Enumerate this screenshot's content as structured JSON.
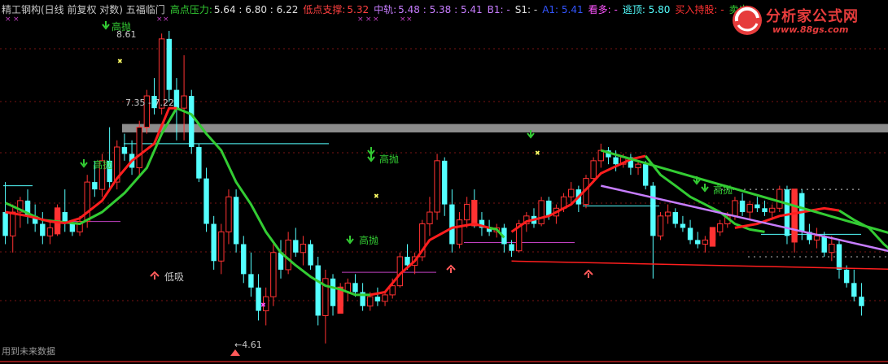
{
  "header": {
    "title": "精工钢构(日线 前复权 对数) 五福临门",
    "high_press_label": "高点压力:",
    "high_press_values": "5.64 : 6.80 : 6.22",
    "low_support_label": "低点支撑:",
    "low_support_value": "5.32",
    "mid_label": "中轨:",
    "mid_values": "5.48 : 5.38 : 5.41",
    "b1": "B1: -",
    "s1": "S1: -",
    "a1": "A1: 5.41",
    "look_long": "看多: -",
    "escape_top": "逃顶: 5.80",
    "buy_hold": "买入持股: -",
    "sell": "卖出"
  },
  "watermark": {
    "title": "分析家公式网",
    "url": "www.88gs.com"
  },
  "footer_note": "用到未来数据",
  "colors": {
    "up": "#ff3232",
    "down": "#54ffff",
    "green_line": "#33cc33",
    "red_line": "#ff1e1e",
    "purple_line": "#c77dff",
    "grid": "#7a1414",
    "header_title": "#c8c8c8"
  },
  "chart_data": {
    "type": "candlestick",
    "price_range": [
      4.5,
      9.2
    ],
    "candles": [
      [
        6.1,
        6.5,
        5.7,
        5.8
      ],
      [
        5.8,
        6.2,
        5.6,
        6.1
      ],
      [
        6.1,
        6.3,
        5.9,
        6.25
      ],
      [
        6.25,
        6.4,
        5.95,
        6.05
      ],
      [
        6.05,
        6.2,
        5.85,
        5.95
      ],
      [
        5.95,
        6.1,
        5.7,
        5.8
      ],
      [
        5.8,
        6.0,
        5.7,
        5.9
      ],
      [
        5.9,
        6.2,
        5.8,
        6.1
      ],
      [
        6.1,
        6.4,
        5.85,
        5.95
      ],
      [
        5.95,
        6.0,
        5.8,
        5.85
      ],
      [
        5.85,
        6.05,
        5.8,
        5.98
      ],
      [
        5.98,
        6.6,
        5.9,
        6.5
      ],
      [
        6.5,
        6.8,
        6.3,
        6.4
      ],
      [
        6.4,
        6.9,
        6.3,
        6.8
      ],
      [
        6.8,
        7.3,
        6.4,
        6.5
      ],
      [
        6.5,
        7.1,
        6.4,
        7.0
      ],
      [
        7.0,
        7.2,
        6.8,
        6.9
      ],
      [
        6.9,
        7.1,
        6.6,
        6.7
      ],
      [
        6.7,
        7.4,
        6.6,
        7.3
      ],
      [
        7.3,
        7.9,
        7.2,
        7.8
      ],
      [
        7.8,
        8.1,
        7.5,
        7.6
      ],
      [
        7.6,
        8.9,
        7.5,
        8.8
      ],
      [
        8.8,
        8.95,
        7.7,
        7.9
      ],
      [
        7.9,
        8.1,
        7.1,
        7.6
      ],
      [
        7.6,
        8.5,
        7.1,
        7.8
      ],
      [
        7.8,
        7.9,
        6.9,
        7.0
      ],
      [
        7.0,
        7.05,
        6.5,
        6.55
      ],
      [
        6.55,
        6.7,
        5.85,
        5.95
      ],
      [
        5.95,
        6.05,
        5.4,
        5.5
      ],
      [
        5.5,
        5.95,
        5.35,
        5.85
      ],
      [
        5.85,
        6.4,
        5.7,
        6.3
      ],
      [
        6.3,
        6.4,
        5.6,
        5.7
      ],
      [
        5.7,
        5.8,
        5.25,
        5.35
      ],
      [
        5.35,
        5.6,
        5.1,
        5.2
      ],
      [
        5.2,
        5.35,
        4.85,
        4.95
      ],
      [
        4.95,
        5.2,
        4.8,
        5.1
      ],
      [
        5.1,
        5.7,
        5.0,
        5.6
      ],
      [
        5.6,
        5.75,
        5.3,
        5.4
      ],
      [
        5.4,
        5.85,
        5.35,
        5.75
      ],
      [
        5.75,
        5.9,
        5.55,
        5.6
      ],
      [
        5.6,
        5.8,
        5.45,
        5.7
      ],
      [
        5.7,
        5.75,
        5.4,
        5.45
      ],
      [
        5.45,
        5.55,
        4.8,
        4.9
      ],
      [
        4.9,
        5.4,
        4.62,
        5.3
      ],
      [
        5.3,
        5.35,
        4.9,
        5.0
      ],
      [
        5.0,
        5.25,
        4.95,
        5.15
      ],
      [
        5.15,
        5.3,
        5.05,
        5.25
      ],
      [
        5.25,
        5.35,
        5.1,
        5.15
      ],
      [
        5.15,
        5.25,
        4.95,
        5.0
      ],
      [
        5.0,
        5.15,
        4.95,
        5.1
      ],
      [
        5.1,
        5.2,
        5.0,
        5.05
      ],
      [
        5.05,
        5.15,
        5.0,
        5.12
      ],
      [
        5.12,
        5.3,
        5.08,
        5.22
      ],
      [
        5.22,
        5.6,
        5.2,
        5.55
      ],
      [
        5.55,
        5.7,
        5.4,
        5.45
      ],
      [
        5.45,
        5.6,
        5.35,
        5.55
      ],
      [
        5.55,
        6.0,
        5.5,
        5.95
      ],
      [
        5.95,
        6.3,
        5.8,
        6.1
      ],
      [
        6.1,
        6.9,
        6.0,
        6.8
      ],
      [
        6.8,
        6.85,
        6.05,
        6.2
      ],
      [
        6.2,
        6.4,
        5.6,
        5.7
      ],
      [
        5.7,
        6.1,
        5.65,
        6.0
      ],
      [
        6.0,
        6.3,
        5.9,
        6.2
      ],
      [
        6.2,
        6.4,
        5.9,
        6.0
      ],
      [
        6.0,
        6.1,
        5.8,
        5.9
      ],
      [
        5.9,
        6.0,
        5.8,
        5.85
      ],
      [
        5.85,
        5.95,
        5.78,
        5.9
      ],
      [
        5.9,
        5.95,
        5.6,
        5.7
      ],
      [
        5.7,
        5.75,
        5.55,
        5.62
      ],
      [
        5.62,
        6.0,
        5.6,
        5.95
      ],
      [
        5.95,
        6.1,
        5.85,
        6.05
      ],
      [
        6.05,
        6.15,
        5.9,
        5.95
      ],
      [
        5.95,
        6.3,
        5.92,
        6.25
      ],
      [
        6.25,
        6.3,
        6.0,
        6.05
      ],
      [
        6.05,
        6.2,
        5.95,
        6.15
      ],
      [
        6.15,
        6.35,
        6.1,
        6.3
      ],
      [
        6.3,
        6.5,
        6.2,
        6.4
      ],
      [
        6.4,
        6.45,
        6.1,
        6.2
      ],
      [
        6.2,
        6.6,
        6.15,
        6.55
      ],
      [
        6.55,
        6.85,
        6.5,
        6.8
      ],
      [
        6.8,
        7.05,
        6.7,
        6.95
      ],
      [
        6.95,
        7.0,
        6.75,
        6.85
      ],
      [
        6.85,
        6.95,
        6.65,
        6.75
      ],
      [
        6.75,
        6.9,
        6.7,
        6.85
      ],
      [
        6.85,
        6.9,
        6.6,
        6.7
      ],
      [
        6.7,
        6.8,
        6.6,
        6.75
      ],
      [
        6.75,
        6.8,
        6.4,
        6.45
      ],
      [
        6.45,
        6.5,
        5.3,
        5.8
      ],
      [
        5.8,
        6.1,
        5.75,
        6.05
      ],
      [
        6.05,
        6.2,
        5.95,
        6.1
      ],
      [
        6.1,
        6.15,
        5.9,
        5.95
      ],
      [
        5.95,
        6.05,
        5.85,
        5.9
      ],
      [
        5.9,
        6.0,
        5.7,
        5.75
      ],
      [
        5.75,
        5.85,
        5.65,
        5.7
      ],
      [
        5.7,
        5.8,
        5.6,
        5.75
      ],
      [
        5.75,
        5.9,
        5.7,
        5.85
      ],
      [
        5.85,
        6.0,
        5.8,
        5.95
      ],
      [
        5.95,
        6.1,
        5.9,
        6.05
      ],
      [
        6.05,
        6.3,
        6.0,
        6.25
      ],
      [
        6.25,
        6.35,
        6.05,
        6.1
      ],
      [
        6.1,
        6.25,
        6.0,
        6.2
      ],
      [
        6.2,
        6.3,
        6.1,
        6.15
      ],
      [
        6.15,
        6.25,
        6.05,
        6.1
      ],
      [
        6.1,
        6.2,
        6.0,
        6.15
      ],
      [
        6.15,
        6.45,
        6.1,
        6.4
      ],
      [
        6.4,
        6.45,
        5.7,
        5.8
      ],
      [
        5.8,
        6.4,
        5.6,
        6.35
      ],
      [
        6.35,
        6.4,
        5.75,
        5.85
      ],
      [
        5.85,
        5.95,
        5.7,
        5.75
      ],
      [
        5.75,
        5.9,
        5.65,
        5.8
      ],
      [
        5.8,
        5.85,
        5.55,
        5.6
      ],
      [
        5.6,
        5.8,
        5.5,
        5.7
      ],
      [
        5.7,
        5.75,
        5.3,
        5.4
      ],
      [
        5.4,
        5.45,
        5.2,
        5.25
      ],
      [
        5.25,
        5.4,
        5.05,
        5.1
      ],
      [
        5.1,
        5.25,
        4.9,
        5.0
      ]
    ],
    "green_line": [
      [
        0,
        6.22
      ],
      [
        5,
        6.0
      ],
      [
        10,
        5.95
      ],
      [
        13,
        6.1
      ],
      [
        16,
        6.35
      ],
      [
        19,
        6.7
      ],
      [
        21,
        7.2
      ],
      [
        23,
        7.6
      ],
      [
        25,
        7.5
      ],
      [
        27,
        7.2
      ],
      [
        29,
        6.95
      ],
      [
        31,
        6.5
      ],
      [
        33,
        6.2
      ],
      [
        35,
        5.85
      ],
      [
        37,
        5.6
      ],
      [
        39,
        5.45
      ],
      [
        41,
        5.32
      ],
      [
        43,
        5.22
      ],
      [
        45,
        5.18
      ],
      [
        47,
        5.12
      ],
      [
        49,
        5.12
      ]
    ],
    "red_line": [
      [
        0,
        6.1
      ],
      [
        3,
        6.05
      ],
      [
        6,
        5.98
      ],
      [
        8,
        5.96
      ],
      [
        10,
        6.02
      ],
      [
        13,
        6.25
      ],
      [
        15,
        6.55
      ],
      [
        17,
        6.8
      ],
      [
        20,
        7.05
      ],
      [
        22,
        7.6
      ],
      [
        23,
        7.6
      ]
    ],
    "red_line2": [
      [
        49,
        5.12
      ],
      [
        51,
        5.15
      ],
      [
        53,
        5.35
      ],
      [
        55,
        5.5
      ],
      [
        57,
        5.75
      ],
      [
        60,
        5.9
      ],
      [
        63,
        5.95
      ],
      [
        65,
        5.9
      ],
      [
        66,
        5.88
      ]
    ],
    "green_line3": [
      [
        65,
        5.9
      ],
      [
        66,
        5.88
      ],
      [
        67,
        5.78
      ]
    ],
    "red_line3": [
      [
        68,
        5.85
      ],
      [
        70,
        5.98
      ],
      [
        73,
        6.05
      ],
      [
        76,
        6.2
      ],
      [
        78,
        6.4
      ],
      [
        80,
        6.62
      ],
      [
        82,
        6.72
      ],
      [
        84,
        6.82
      ],
      [
        86,
        6.87
      ]
    ],
    "green_line4": [
      [
        86,
        6.87
      ],
      [
        88,
        6.6
      ],
      [
        90,
        6.45
      ],
      [
        92,
        6.3
      ],
      [
        94,
        6.2
      ],
      [
        96,
        6.1
      ],
      [
        98,
        5.95
      ],
      [
        100,
        5.88
      ],
      [
        102,
        5.85
      ]
    ],
    "red_line4": [
      [
        98,
        5.9
      ],
      [
        101,
        5.95
      ],
      [
        104,
        6.05
      ],
      [
        107,
        6.1
      ],
      [
        110,
        6.15
      ],
      [
        112,
        6.12
      ]
    ],
    "green_line5": [
      [
        112,
        6.12
      ],
      [
        114,
        6.0
      ],
      [
        116,
        5.9
      ],
      [
        118,
        5.7
      ],
      [
        120,
        5.55
      ],
      [
        122,
        5.45
      ]
    ],
    "green_trend": [
      [
        80,
        6.95
      ],
      [
        122,
        5.75
      ]
    ],
    "purple_trend": [
      [
        80,
        6.45
      ],
      [
        122,
        5.55
      ]
    ],
    "red_flat": [
      [
        68,
        5.5
      ],
      [
        122,
        5.4
      ]
    ],
    "notes": [
      "高抛",
      "高抛",
      "高抛",
      "高抛",
      "高抛",
      "低吸"
    ],
    "labels": {
      "high": "8.61",
      "range": "7.35 - 7.22",
      "low": "4.61",
      "gaopao": "高抛",
      "dixi": "低吸"
    }
  }
}
